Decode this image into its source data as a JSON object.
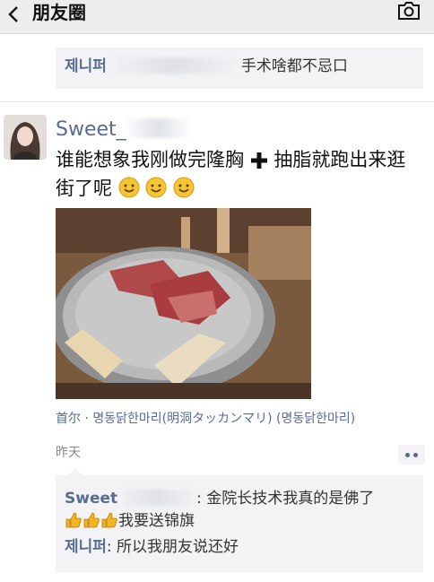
{
  "header": {
    "title": "朋友圈",
    "back_icon": "back-chevron-icon",
    "camera_icon": "camera-icon",
    "background": "#ededed"
  },
  "previous_comment": {
    "author": "제니퍼",
    "text": "手术啥都不忌口"
  },
  "post": {
    "author": "Sweet_",
    "text_line1": "谁能想象我刚做完隆胸",
    "text_line1b": "抽脂就跑出来逛",
    "text_line2": "街了呢",
    "plus_icon": "heavy-plus-icon",
    "emoji": "blush-smile-emoji",
    "location": "首尔 · 명동닭한마리(明洞タッカンマリ) (명동닭한마리)",
    "time": "昨天"
  },
  "comments": [
    {
      "author": "Sweet",
      "text": ": 金院长技术我真的是佛了",
      "text2": "我要送锦旗",
      "icons": [
        "thumbs-up-emoji",
        "thumbs-up-emoji",
        "thumbs-up-emoji"
      ]
    },
    {
      "author": "제니퍼",
      "text": ": 所以我朋友说还好"
    }
  ],
  "colors": {
    "link": "#576b95",
    "comment_bg": "#f3f3f5"
  }
}
